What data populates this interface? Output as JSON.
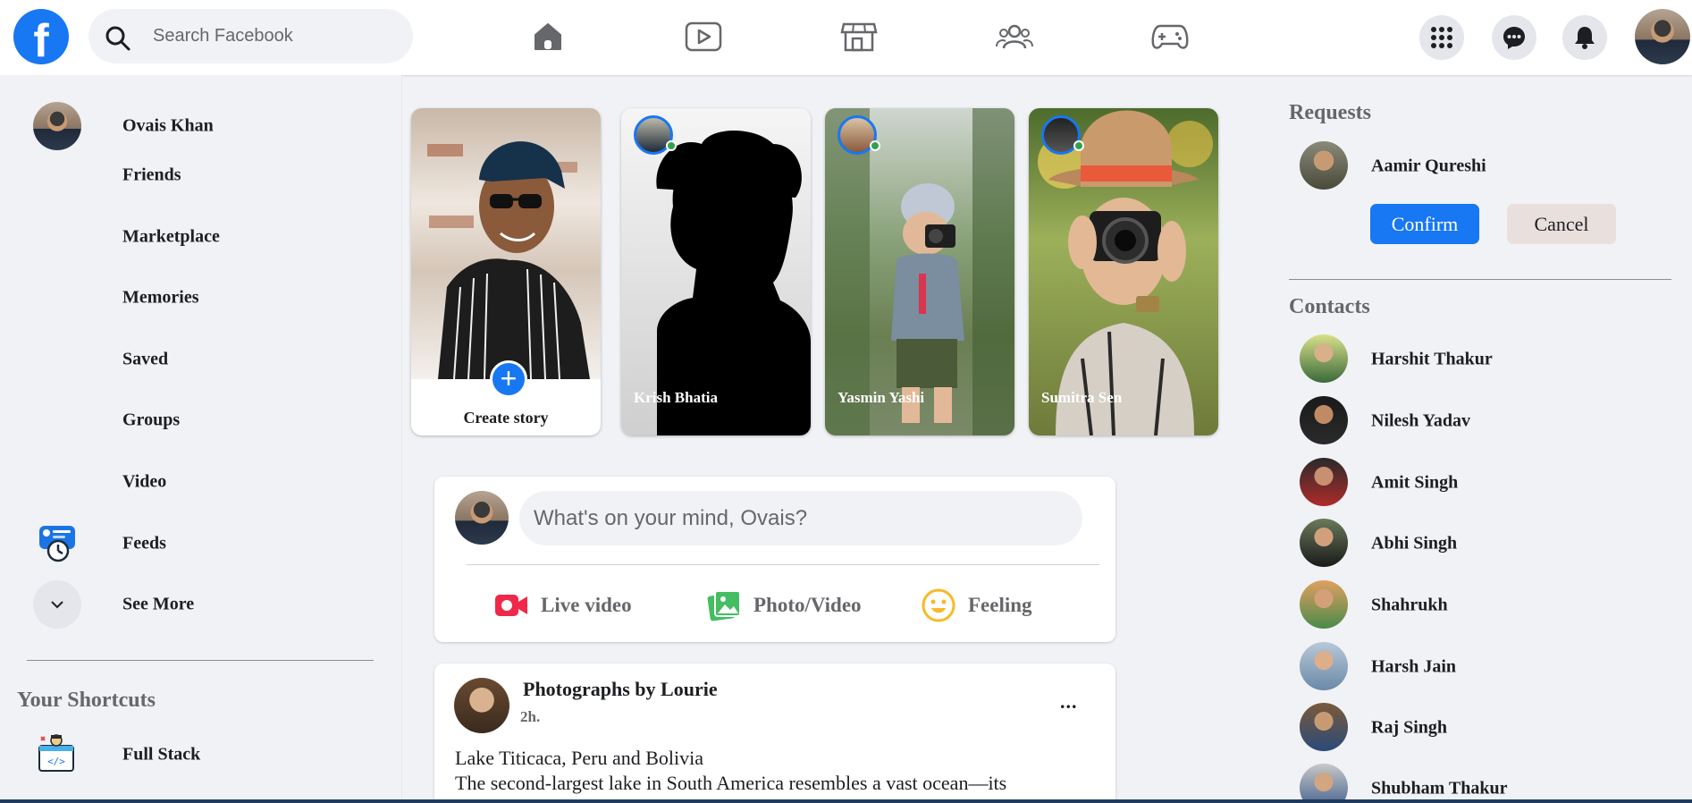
{
  "colors": {
    "brand": "#1877f2",
    "online": "#31a24c",
    "live": "#f02849",
    "photo": "#45bd62",
    "feeling": "#f7b928"
  },
  "topbar": {
    "logo_letter": "f",
    "search_placeholder": "Search Facebook",
    "nav_icons": [
      "home-icon",
      "video-icon",
      "marketplace-icon",
      "groups-icon",
      "gaming-icon"
    ],
    "action_icons": [
      "menu-grid-icon",
      "messenger-icon",
      "notifications-icon"
    ]
  },
  "sidebar": {
    "items": [
      {
        "label": "Ovais Khan"
      },
      {
        "label": "Friends"
      },
      {
        "label": "Marketplace"
      },
      {
        "label": "Memories"
      },
      {
        "label": "Saved"
      },
      {
        "label": "Groups"
      },
      {
        "label": "Video"
      },
      {
        "label": "Feeds"
      },
      {
        "label": "See More"
      }
    ],
    "shortcuts_title": "Your Shortcuts",
    "shortcuts": [
      {
        "label": "Full Stack"
      }
    ]
  },
  "stories": {
    "create_label": "Create story",
    "create_icon": "+",
    "items": [
      {
        "name": "Krish Bhatia"
      },
      {
        "name": "Yasmin Yashi"
      },
      {
        "name": "Sumitra Sen"
      }
    ]
  },
  "composer": {
    "placeholder": "What's on your mind, Ovais?",
    "actions": [
      {
        "label": "Live video",
        "icon": "live-video-icon"
      },
      {
        "label": "Photo/Video",
        "icon": "photo-video-icon"
      },
      {
        "label": "Feeling",
        "icon": "feeling-icon"
      }
    ]
  },
  "post": {
    "author": "Photographs by Lourie",
    "time": "2h.",
    "more": "...",
    "line1": "Lake Titicaca, Peru and Bolivia",
    "line2": "The second-largest lake in South America resembles a vast ocean—its"
  },
  "requests": {
    "title": "Requests",
    "name": "Aamir Qureshi",
    "confirm_label": "Confirm",
    "cancel_label": "Cancel"
  },
  "contacts": {
    "title": "Contacts",
    "items": [
      {
        "name": "Harshit Thakur"
      },
      {
        "name": "Nilesh Yadav"
      },
      {
        "name": "Amit Singh"
      },
      {
        "name": "Abhi Singh"
      },
      {
        "name": "Shahrukh"
      },
      {
        "name": "Harsh Jain"
      },
      {
        "name": "Raj Singh"
      },
      {
        "name": "Shubham Thakur"
      }
    ]
  }
}
